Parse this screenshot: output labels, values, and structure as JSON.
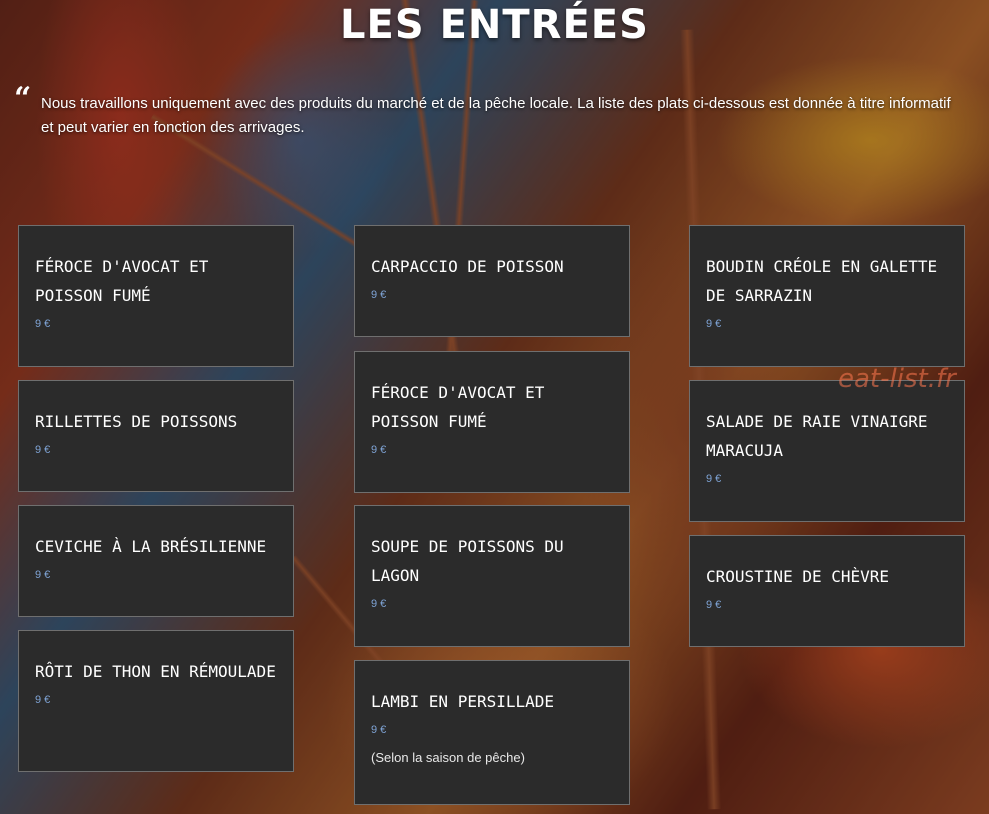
{
  "page": {
    "title": "LES ENTRÉES",
    "quote_mark": "“",
    "intro": "Nous travaillons uniquement avec des produits du marché et de la pêche locale. La liste des plats ci-dessous est donnée à titre informatif et peut varier en fonction des arrivages."
  },
  "watermark": "eat-list.fr",
  "columns": [
    {
      "items": [
        {
          "name": "FÉROCE D'AVOCAT ET POISSON FUMÉ",
          "price": "9 €"
        },
        {
          "name": "RILLETTES DE POISSONS",
          "price": "9 €"
        },
        {
          "name": "CEVICHE À LA BRÉSILIENNE",
          "price": "9 €"
        },
        {
          "name": "RÔTI DE THON EN RÉMOULADE",
          "price": "9 €"
        }
      ]
    },
    {
      "items": [
        {
          "name": "CARPACCIO DE POISSON",
          "price": "9 €"
        },
        {
          "name": "FÉROCE D'AVOCAT ET POISSON FUMÉ",
          "price": "9 €"
        },
        {
          "name": "SOUPE DE POISSONS DU LAGON",
          "price": "9 €"
        },
        {
          "name": "LAMBI EN PERSILLADE",
          "price": "9 €",
          "note": "(Selon la saison de pêche)"
        }
      ]
    },
    {
      "items": [
        {
          "name": "BOUDIN CRÉOLE EN GALETTE DE SARRAZIN",
          "price": "9 €"
        },
        {
          "name": "SALADE DE RAIE VINAIGRE MARACUJA",
          "price": "9 €"
        },
        {
          "name": "CROUSTINE DE CHÈVRE",
          "price": "9 €"
        }
      ]
    }
  ],
  "colors": {
    "card_background": "#2b2b2b",
    "card_border": "#6f6f6f",
    "price_color": "#7fa4d6",
    "text_color": "#ffffff"
  }
}
